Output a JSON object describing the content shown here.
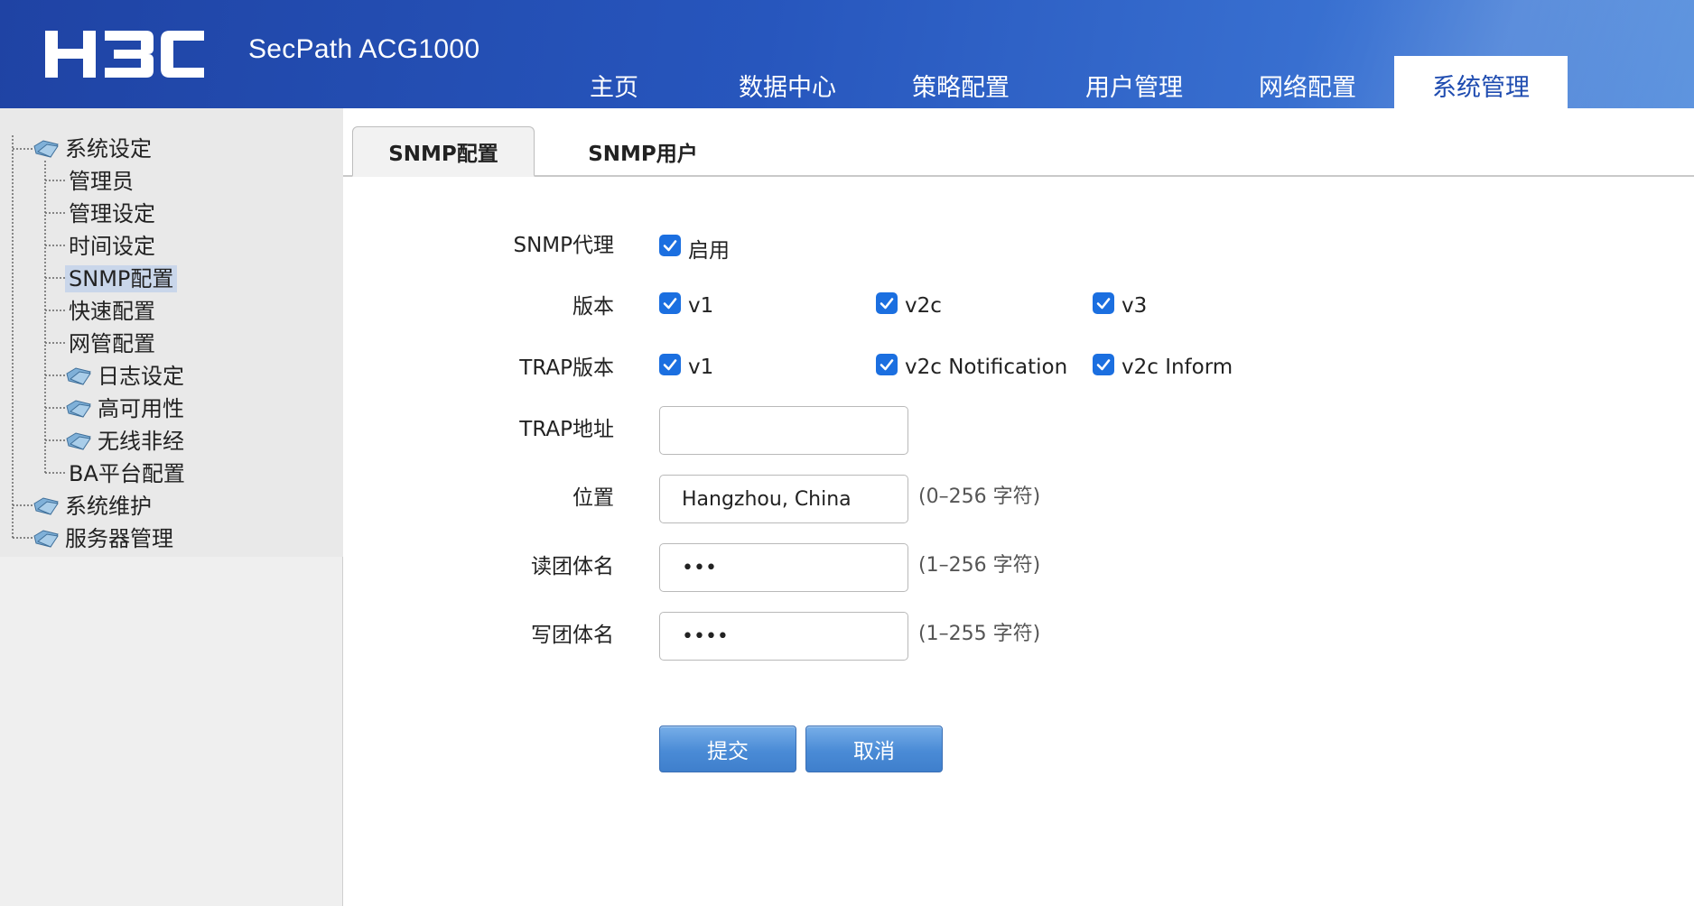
{
  "header": {
    "logo_text": "H3C",
    "product": "SecPath ACG1000",
    "nav": [
      {
        "label": "主页"
      },
      {
        "label": "数据中心"
      },
      {
        "label": "策略配置"
      },
      {
        "label": "用户管理"
      },
      {
        "label": "网络配置"
      },
      {
        "label": "系统管理",
        "active": true
      }
    ]
  },
  "sidebar": {
    "tree": [
      {
        "label": "系统设定",
        "folder": true,
        "expanded": true
      },
      {
        "label": "管理员"
      },
      {
        "label": "管理设定"
      },
      {
        "label": "时间设定"
      },
      {
        "label": "SNMP配置",
        "selected": true
      },
      {
        "label": "快速配置"
      },
      {
        "label": "网管配置"
      },
      {
        "label": "日志设定",
        "folder": true
      },
      {
        "label": "高可用性",
        "folder": true
      },
      {
        "label": "无线非经",
        "folder": true
      },
      {
        "label": "BA平台配置"
      },
      {
        "label": "系统维护",
        "folder": true
      },
      {
        "label": "服务器管理",
        "folder": true
      }
    ]
  },
  "tabs": [
    {
      "label": "SNMP配置",
      "active": true
    },
    {
      "label": "SNMP用户"
    }
  ],
  "form": {
    "agent": {
      "label": "SNMP代理",
      "option": "启用",
      "checked": true
    },
    "version": {
      "label": "版本",
      "options": [
        {
          "text": "v1",
          "checked": true
        },
        {
          "text": "v2c",
          "checked": true
        },
        {
          "text": "v3",
          "checked": true
        }
      ]
    },
    "trap_version": {
      "label": "TRAP版本",
      "options": [
        {
          "text": "v1",
          "checked": true
        },
        {
          "text": "v2c Notification",
          "checked": true
        },
        {
          "text": "v2c Inform",
          "checked": true
        }
      ]
    },
    "trap_address": {
      "label": "TRAP地址",
      "value": ""
    },
    "location": {
      "label": "位置",
      "value": "Hangzhou, China",
      "hint": "(0–256 字符)"
    },
    "read_community": {
      "label": "读团体名",
      "value": "•••",
      "hint": "(1–256 字符)"
    },
    "write_community": {
      "label": "写团体名",
      "value": "••••",
      "hint": "(1–255 字符)"
    }
  },
  "buttons": {
    "submit": "提交",
    "cancel": "取消"
  },
  "colors": {
    "header_blue": "#2756bd",
    "checkbox_blue": "#1b6fe0",
    "button_blue": "#4a8bd6"
  }
}
